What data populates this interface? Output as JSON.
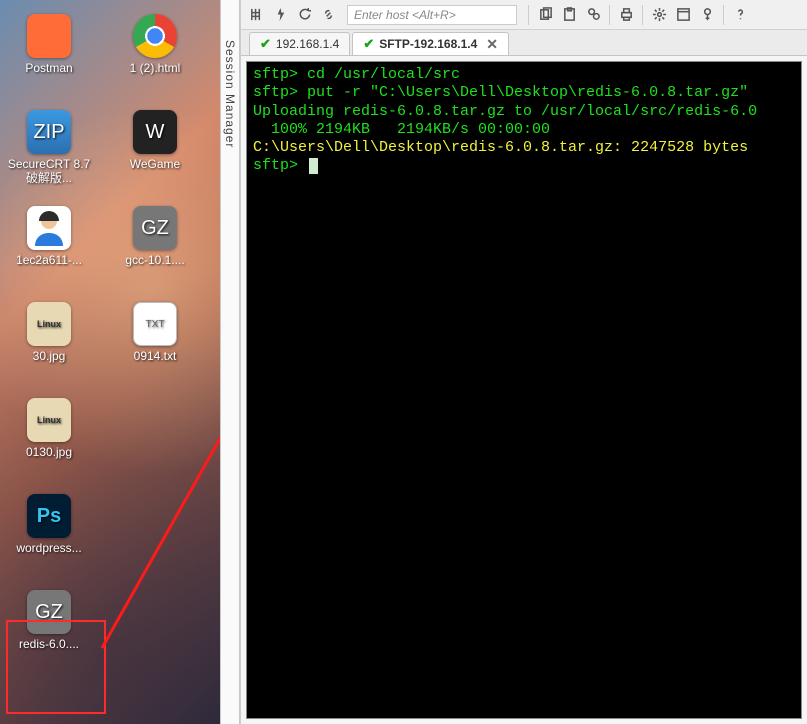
{
  "desktop": {
    "icons": [
      {
        "label": "Postman",
        "name": "postman-icon",
        "glyph": "postman",
        "char": ""
      },
      {
        "label": "1 (2).html",
        "name": "html-file-icon",
        "glyph": "chrome",
        "char": ""
      },
      {
        "label": "SecureCRT 8.7破解版...",
        "name": "securecrt-icon",
        "glyph": "zip",
        "char": "ZIP"
      },
      {
        "label": "WeGame",
        "name": "wegame-icon",
        "glyph": "wegame",
        "char": "W"
      },
      {
        "label": "1ec2a611-...",
        "name": "avatar-file-icon",
        "glyph": "avatar",
        "char": ""
      },
      {
        "label": "gcc-10.1....",
        "name": "gcc-archive-icon",
        "glyph": "gz",
        "char": "GZ"
      },
      {
        "label": "30.jpg",
        "name": "jpg-30-icon",
        "glyph": "jpg",
        "char": "Linux"
      },
      {
        "label": "0914.txt",
        "name": "txt-0914-icon",
        "glyph": "txt",
        "char": "TXT"
      },
      {
        "label": "0130.jpg",
        "name": "jpg-0130-icon",
        "glyph": "jpg",
        "char": "Linux"
      },
      {
        "label": "",
        "name": "spacer",
        "glyph": "",
        "char": ""
      },
      {
        "label": "wordpress...",
        "name": "wordpress-psd-icon",
        "glyph": "ps",
        "char": "Ps"
      },
      {
        "label": "",
        "name": "spacer2",
        "glyph": "",
        "char": ""
      },
      {
        "label": "redis-6.0....",
        "name": "redis-archive-icon",
        "glyph": "gz",
        "char": "GZ"
      }
    ]
  },
  "session_strip": {
    "label": "Session Manager"
  },
  "toolbar": {
    "host_placeholder": "Enter host <Alt+R>"
  },
  "tabs": [
    {
      "label": "192.168.1.4",
      "active": false
    },
    {
      "label": "SFTP-192.168.1.4",
      "active": true
    }
  ],
  "terminal": {
    "lines": [
      {
        "cls": "g",
        "text": "sftp> cd /usr/local/src"
      },
      {
        "cls": "g",
        "text": "sftp> put -r \"C:\\Users\\Dell\\Desktop\\redis-6.0.8.tar.gz\" "
      },
      {
        "cls": "g",
        "text": "Uploading redis-6.0.8.tar.gz to /usr/local/src/redis-6.0"
      },
      {
        "cls": "g",
        "text": "  100% 2194KB   2194KB/s 00:00:00"
      },
      {
        "cls": "y",
        "text": "C:\\Users\\Dell\\Desktop\\redis-6.0.8.tar.gz: 2247528 bytes "
      },
      {
        "cls": "g",
        "text": "sftp> "
      }
    ]
  }
}
